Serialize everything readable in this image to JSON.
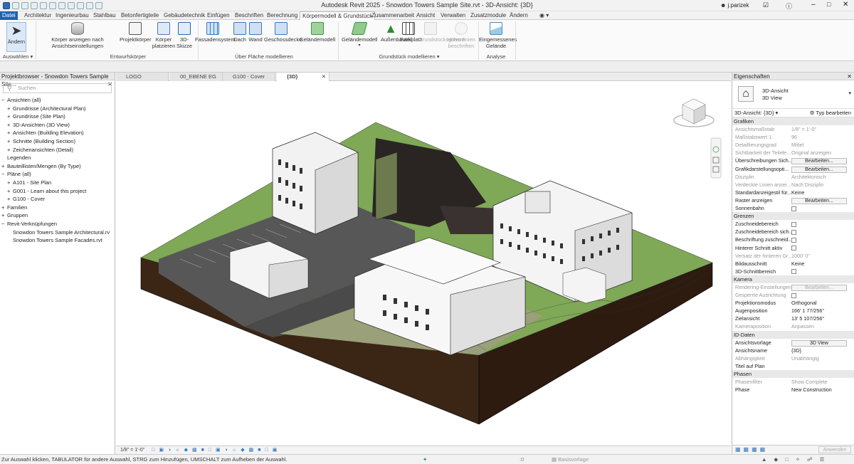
{
  "title": "Autodesk Revit 2025 - Snowdon Towers Sample Site.rvt - 3D-Ansicht: {3D}",
  "user": "j.parizek",
  "menu": [
    "Datei",
    "Architektur",
    "Ingenieurbau",
    "Stahlbau",
    "Betonfertigteile",
    "Gebäudetechnik",
    "Einfügen",
    "Beschriften",
    "Berechnung",
    "Körpermodell & Grundstück",
    "Zusammenarbeit",
    "Ansicht",
    "Verwalten",
    "Zusatzmodule",
    "Ändern"
  ],
  "ribbon": {
    "aendern": "Ändern",
    "auswaehlen": "Auswählen",
    "koerper_anzeigen": "Körper anzeigen nach Ansichtseinstellungen",
    "projektkoerper": "Projektkörper",
    "koerper_platzieren": "Körper platzieren",
    "skizze_3d": "3D-Skizze",
    "entwurfskoerper": "Entwurfskörper",
    "fassadensystem": "Fassadensystem",
    "dach": "Dach",
    "wand": "Wand",
    "geschossdecke": "Geschossdecke",
    "gelaendemodell_flaeche": "Geländemodell",
    "ueber_flaeche": "Über Fläche modellieren",
    "gelaendemodell": "Geländemodell",
    "aussenbauteil": "Außenbauteil",
    "parkplatz": "Parkplatz",
    "grundstuecksgrenze": "Grundstücksgrenze",
    "hoehenlinien": "Höhenlinien beschriften",
    "grundstueck": "Grundstück modellieren",
    "eingemessen": "Eingemessenes Gelände",
    "analyse": "Analyse"
  },
  "project_browser": {
    "title": "Projektbrowser - Snowdon Towers Sample Site...",
    "search": "Suchen",
    "items": [
      {
        "label": "Ansichten (all)",
        "lvl": 0,
        "sym": "−"
      },
      {
        "label": "Grundrisse (Architectural Plan)",
        "lvl": 1,
        "sym": "+"
      },
      {
        "label": "Grundrisse (Site Plan)",
        "lvl": 1,
        "sym": "+"
      },
      {
        "label": "3D-Ansichten (3D View)",
        "lvl": 1,
        "sym": "+"
      },
      {
        "label": "Ansichten (Building Elevation)",
        "lvl": 1,
        "sym": "+"
      },
      {
        "label": "Schnitte (Building Section)",
        "lvl": 1,
        "sym": "+"
      },
      {
        "label": "Zeichenansichten (Detail)",
        "lvl": 1,
        "sym": "+"
      },
      {
        "label": "Legenden",
        "lvl": 0,
        "sym": ""
      },
      {
        "label": "Bauteillisten/Mengen (By Type)",
        "lvl": 0,
        "sym": "+"
      },
      {
        "label": "Pläne (all)",
        "lvl": 0,
        "sym": "−"
      },
      {
        "label": "A101 - Site Plan",
        "lvl": 1,
        "sym": "+"
      },
      {
        "label": "G001 - Learn about this project",
        "lvl": 1,
        "sym": "+"
      },
      {
        "label": "G100 - Cover",
        "lvl": 1,
        "sym": "+"
      },
      {
        "label": "Familien",
        "lvl": 0,
        "sym": "+"
      },
      {
        "label": "Gruppen",
        "lvl": 0,
        "sym": "+"
      },
      {
        "label": "Revit-Verknüpfungen",
        "lvl": 0,
        "sym": "−"
      },
      {
        "label": "Snowdon Towers Sample Architectural.rv",
        "lvl": 1,
        "sym": ""
      },
      {
        "label": "Snowdon Towers Sample Facades.rvt",
        "lvl": 1,
        "sym": ""
      }
    ]
  },
  "doc_tabs": [
    "LOGO",
    "00_EBENE EG",
    "G100 - Cover",
    "{3D}"
  ],
  "view_scale": "1/8\" = 1'-0\"",
  "properties": {
    "title": "Eigenschaften",
    "type_name": "3D-Ansicht",
    "type_sub": "3D View",
    "instance": "3D-Ansicht: {3D}",
    "edit_type": "Typ bearbeiten",
    "sections": [
      {
        "name": "Grafiken",
        "rows": [
          {
            "k": "Ansichtsmaßstab",
            "v": "1/8\" = 1'-0\"",
            "dis": true
          },
          {
            "k": "Maßstabswert 1:",
            "v": "96",
            "dis": true
          },
          {
            "k": "Detaillierungsgrad",
            "v": "Mittel",
            "dis": true
          },
          {
            "k": "Sichtbarkeit der Teilele...",
            "v": "Original anzeigen",
            "dis": true
          },
          {
            "k": "Überschreibungen Sich...",
            "btn": "Bearbeiten..."
          },
          {
            "k": "Grafikdarstellungsopti...",
            "btn": "Bearbeiten..."
          },
          {
            "k": "Disziplin",
            "v": "Architektonisch",
            "dis": true
          },
          {
            "k": "Verdeckte Linien anzei...",
            "v": "Nach Disziplin",
            "dis": true
          },
          {
            "k": "Standardanzeigestil für...",
            "v": "Keine"
          },
          {
            "k": "Raster anzeigen",
            "btn": "Bearbeiten..."
          },
          {
            "k": "Sonnenbahn",
            "chk": true
          }
        ]
      },
      {
        "name": "Grenzen",
        "rows": [
          {
            "k": "Zuschneidebereich",
            "chk": true
          },
          {
            "k": "Zuschneidebereich sich...",
            "chk": true
          },
          {
            "k": "Beschriftung zuschneid...",
            "chk": true
          },
          {
            "k": "Hinterer Schnitt aktiv",
            "chk": true
          },
          {
            "k": "Versatz der hinteren Gr...",
            "v": "1000' 0\"",
            "dis": true
          },
          {
            "k": "Bildausschnitt",
            "v": "Keine"
          },
          {
            "k": "3D-Schnittbereich",
            "chk": true
          }
        ]
      },
      {
        "name": "Kamera",
        "rows": [
          {
            "k": "Rendering-Einstellungen",
            "btn": "Bearbeiten...",
            "dis": true
          },
          {
            "k": "Gesperrte Ausrichtung",
            "dis": true,
            "chk": true
          },
          {
            "k": "Projektionsmodus",
            "v": "Orthogonal"
          },
          {
            "k": "Augenposition",
            "v": "166'  1 77/256\""
          },
          {
            "k": "Zielansicht",
            "v": "13'  5 107/256\""
          },
          {
            "k": "Kameraposition",
            "v": "Anpassen",
            "dis": true
          }
        ]
      },
      {
        "name": "ID-Daten",
        "rows": [
          {
            "k": "Ansichtsvorlage",
            "btn": "3D View"
          },
          {
            "k": "Ansichtsname",
            "v": "{3D}"
          },
          {
            "k": "Abhängigkeit",
            "v": "Unabhängig",
            "dis": true
          },
          {
            "k": "Titel auf Plan",
            "v": ""
          }
        ]
      },
      {
        "name": "Phasen",
        "rows": [
          {
            "k": "Phasenfilter",
            "v": "Show Complete",
            "dis": true
          },
          {
            "k": "Phase",
            "v": "New Construction"
          }
        ]
      }
    ],
    "apply": "Anwenden"
  },
  "status": "Zur Auswahl klicken, TABULATOR für andere Auswahl, STRG zum Hinzufügen, UMSCHALT zum Aufheben der Auswahl.",
  "status_count": ":0",
  "basisvorlage": "Basisvorlage"
}
